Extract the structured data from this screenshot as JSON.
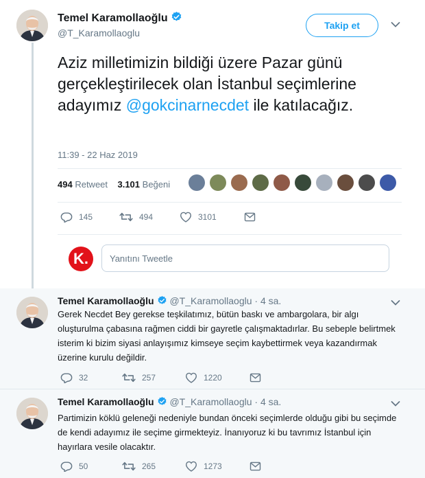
{
  "main_tweet": {
    "author_name": "Temel Karamollaoğlu",
    "author_handle": "@T_Karamollaoglu",
    "follow_label": "Takip et",
    "text_before": "Aziz milletimizin bildiği üzere Pazar günü gerçekleştirilecek olan İstanbul seçimlerine adayımız ",
    "mention": "@gokcinarnecdet",
    "text_after": " ile katılacağız.",
    "timestamp": "11:39 - 22 Haz 2019",
    "retweets_count": "494",
    "retweets_label": "Retweet",
    "likes_count": "3.101",
    "likes_label": "Beğeni",
    "actions": {
      "replies": "145",
      "retweets": "494",
      "likes": "3101"
    },
    "liker_colors": [
      "#6b7f99",
      "#7d8a5a",
      "#9a6b4f",
      "#5e6b47",
      "#8f5a48",
      "#384a3a",
      "#a7b0bd",
      "#6a4e3d",
      "#4c4c4c",
      "#3d5aa8"
    ]
  },
  "reply_box": {
    "placeholder": "Yanıtını Tweetle",
    "avatar_letter": "K."
  },
  "replies": [
    {
      "author_name": "Temel Karamollaoğlu",
      "author_handle": "@T_Karamollaoglu",
      "age": "· 4 sa.",
      "text": "Gerek Necdet Bey gerekse teşkilatımız, bütün baskı ve ambargolara, bir algı oluşturulma çabasına rağmen ciddi bir gayretle çalışmaktadırlar. Bu sebeple belirtmek isterim ki bizim siyasi anlayışımız kimseye seçim kaybettirmek veya kazandırmak üzerine kurulu değildir.",
      "replies": "32",
      "retweets": "257",
      "likes": "1220"
    },
    {
      "author_name": "Temel Karamollaoğlu",
      "author_handle": "@T_Karamollaoglu",
      "age": "· 4 sa.",
      "text": "Partimizin köklü geleneği nedeniyle bundan önceki seçimlerde olduğu gibi bu seçimde de kendi adayımız ile seçime girmekteyiz. İnanıyoruz ki bu tavrımız İstanbul için hayırlara vesile olacaktır.",
      "replies": "50",
      "retweets": "265",
      "likes": "1273"
    }
  ],
  "colors": {
    "accent": "#1da1f2",
    "text": "#14171a",
    "muted": "#657786",
    "reply_bg": "#f5f8fa",
    "verified": "#1da1f2",
    "logo_red": "#e2121a"
  }
}
